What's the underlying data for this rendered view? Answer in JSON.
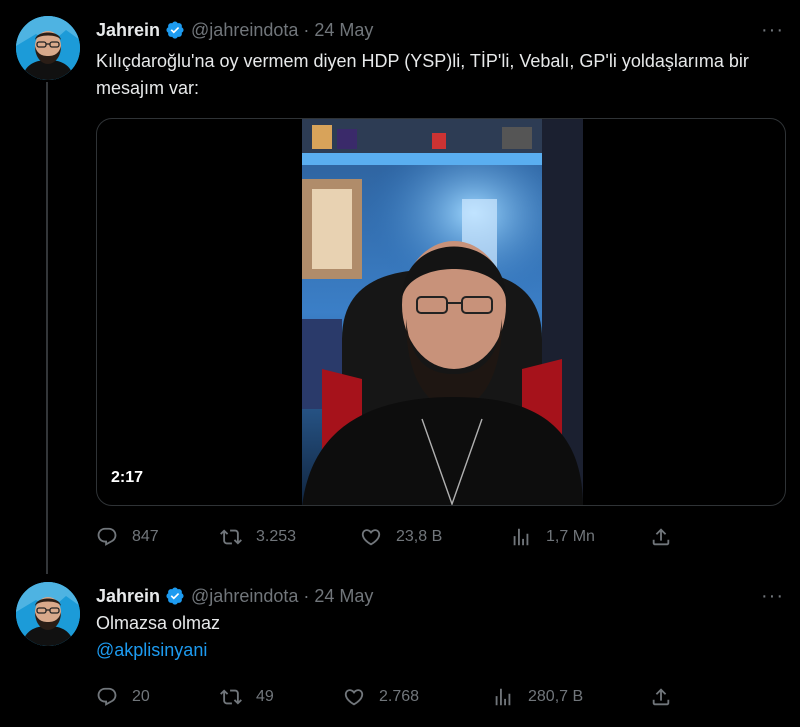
{
  "tweets": [
    {
      "author": {
        "name": "Jahrein",
        "handle": "@jahreindota",
        "verified": true
      },
      "date": "24 May",
      "text": "Kılıçdaroğlu'na oy vermem diyen HDP (YSP)li, TİP'li, Vebalı, GP'li yoldaşlarıma bir mesajım var:",
      "video": {
        "duration": "2:17"
      },
      "stats": {
        "replies": "847",
        "retweets": "3.253",
        "likes": "23,8 B",
        "views": "1,7 Mn"
      }
    },
    {
      "author": {
        "name": "Jahrein",
        "handle": "@jahreindota",
        "verified": true
      },
      "date": "24 May",
      "text": "Olmazsa olmaz",
      "mention": "@akplisinyani",
      "stats": {
        "replies": "20",
        "retweets": "49",
        "likes": "2.768",
        "views": "280,7 B"
      }
    }
  ],
  "ui": {
    "separator": "·",
    "more": "···"
  },
  "colors": {
    "background": "#000000",
    "text": "#e7e9ea",
    "muted": "#71767b",
    "link": "#1d9bf0",
    "verified": "#1d9bf0",
    "border": "#2f3336"
  },
  "icons": [
    "verified-badge-icon",
    "more-icon",
    "reply-icon",
    "retweet-icon",
    "like-icon",
    "views-icon",
    "share-icon"
  ]
}
